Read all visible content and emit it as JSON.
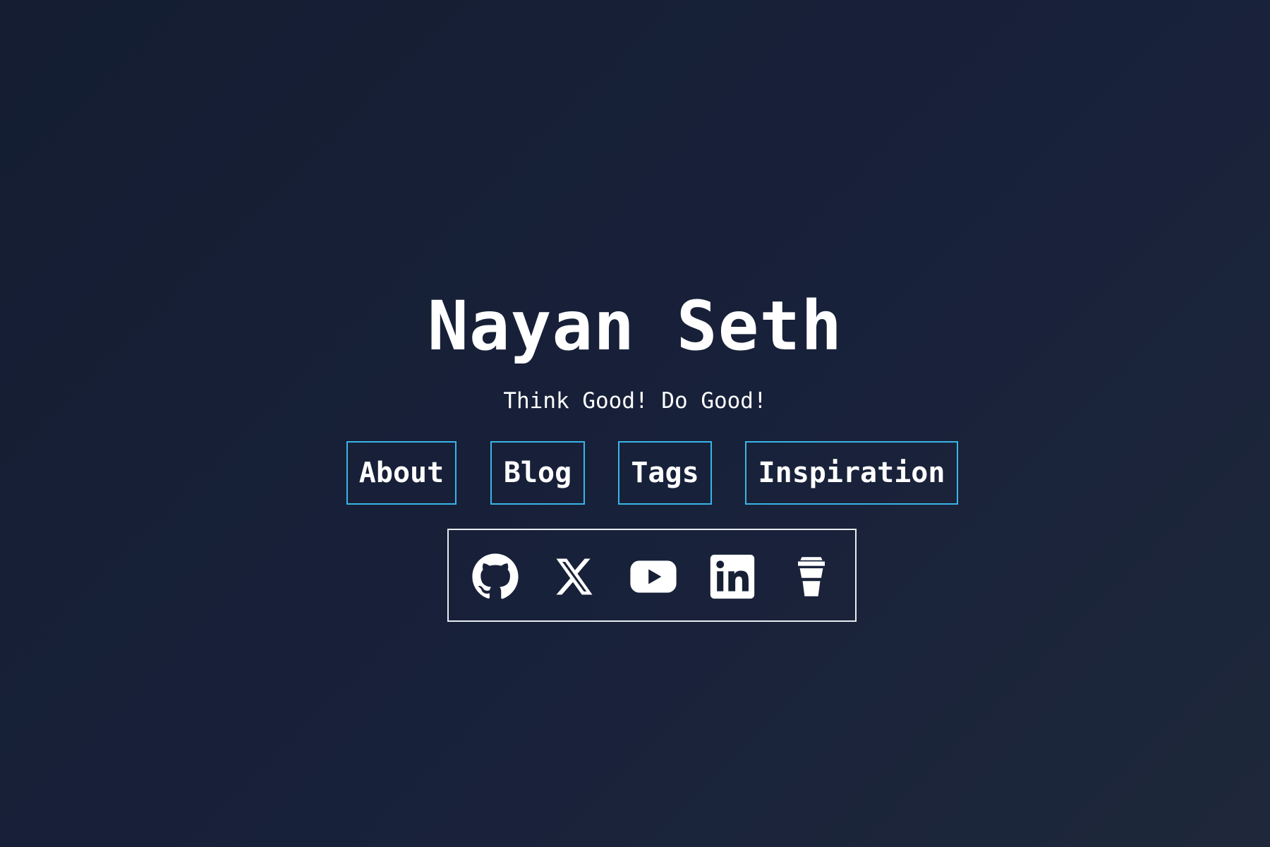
{
  "site": {
    "name": "Nayan Seth",
    "tagline": "Think Good! Do Good!"
  },
  "nav": {
    "items": [
      {
        "label": "About"
      },
      {
        "label": "Blog"
      },
      {
        "label": "Tags"
      },
      {
        "label": "Inspiration"
      }
    ]
  },
  "social": {
    "links": [
      {
        "icon": "github-icon"
      },
      {
        "icon": "x-twitter-icon"
      },
      {
        "icon": "youtube-icon"
      },
      {
        "icon": "linkedin-icon"
      },
      {
        "icon": "coffee-cup-icon"
      }
    ]
  },
  "colors": {
    "background": "#161f34",
    "accent_border": "#38b5e8",
    "social_border": "#e8ecf2",
    "text": "#ffffff"
  }
}
